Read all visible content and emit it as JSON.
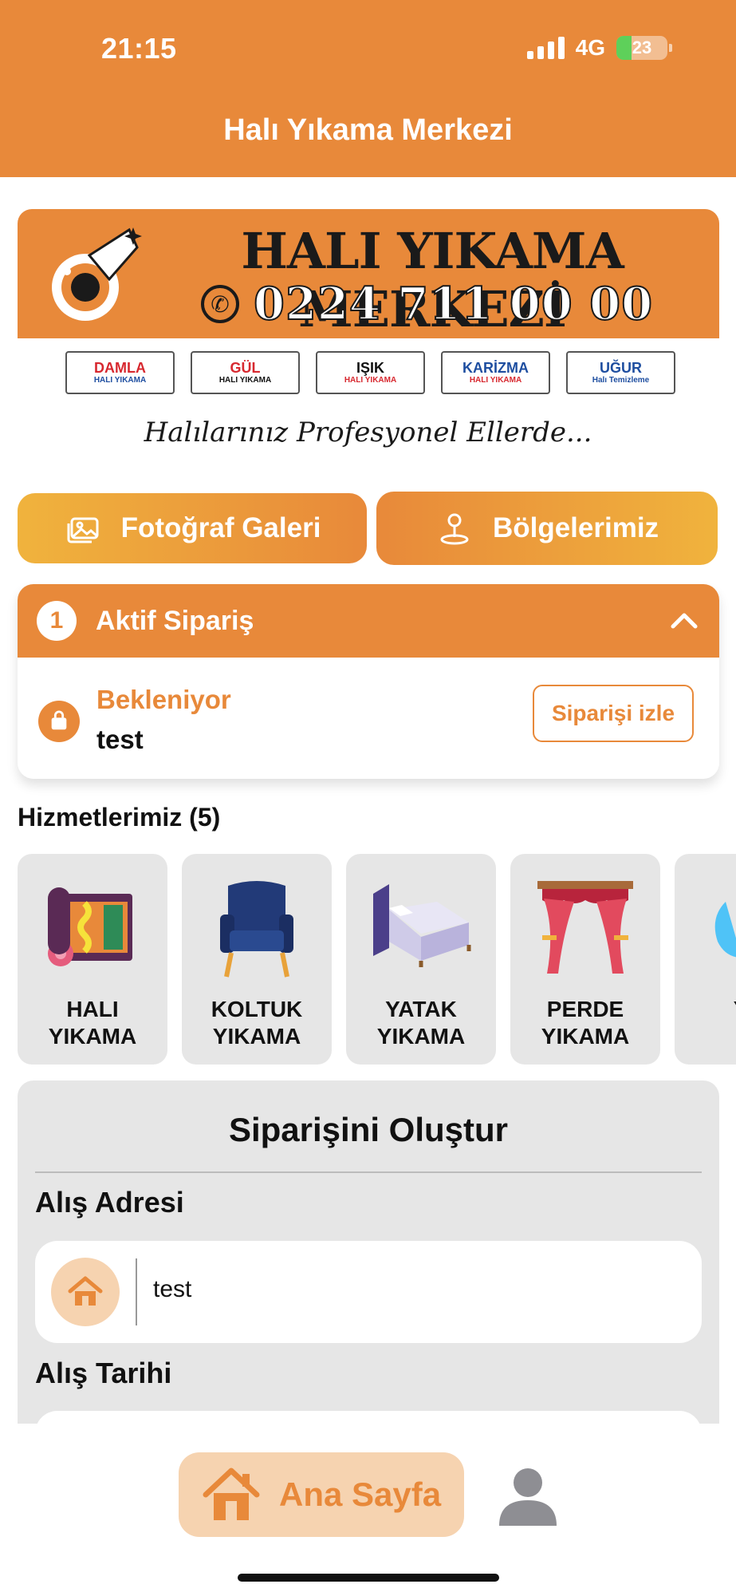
{
  "status_bar": {
    "time": "21:15",
    "network": "4G",
    "battery": "23"
  },
  "header": {
    "title": "Halı Yıkama Merkezi"
  },
  "banner": {
    "title": "HALI YIKAMA MERKEZİ",
    "phone": "0224 711 00 00",
    "tagline": "Halılarınız Profesyonel Ellerde...",
    "brands": [
      {
        "name": "DAMLA",
        "sub": "HALI YIKAMA"
      },
      {
        "name": "GÜL",
        "sub": "HALI YIKAMA"
      },
      {
        "name": "IŞIK",
        "sub": "HALI YIKAMA"
      },
      {
        "name": "KARİZMA",
        "sub": "HALI YIKAMA"
      },
      {
        "name": "UĞUR",
        "sub": "Halı Temizleme"
      }
    ]
  },
  "actions": {
    "gallery_label": "Fotoğraf Galeri",
    "regions_label": "Bölgelerimiz"
  },
  "active_order": {
    "count": "1",
    "title": "Aktif Sipariş",
    "status": "Bekleniyor",
    "name": "test",
    "track_label": "Siparişi izle"
  },
  "services": {
    "title": "Hizmetlerimiz (5)",
    "items": [
      {
        "label": "HALI\nYIKAMA",
        "icon": "carpet-icon"
      },
      {
        "label": "KOLTUK\nYIKAMA",
        "icon": "armchair-icon"
      },
      {
        "label": "YATAK\nYIKAMA",
        "icon": "bed-icon"
      },
      {
        "label": "PERDE\nYIKAMA",
        "icon": "curtain-icon"
      },
      {
        "label": "YO\nY",
        "icon": "blanket-icon"
      }
    ]
  },
  "order_form": {
    "title": "Siparişini Oluştur",
    "address_label": "Alış Adresi",
    "address_value": "test",
    "date_label": "Alış Tarihi"
  },
  "bottom_nav": {
    "home_label": "Ana Sayfa",
    "profile_icon": "user-icon"
  },
  "colors": {
    "accent": "#E8893A",
    "accent_light": "#F6D3B0",
    "gold": "#F0B33D",
    "card_bg": "#E6E6E6"
  }
}
